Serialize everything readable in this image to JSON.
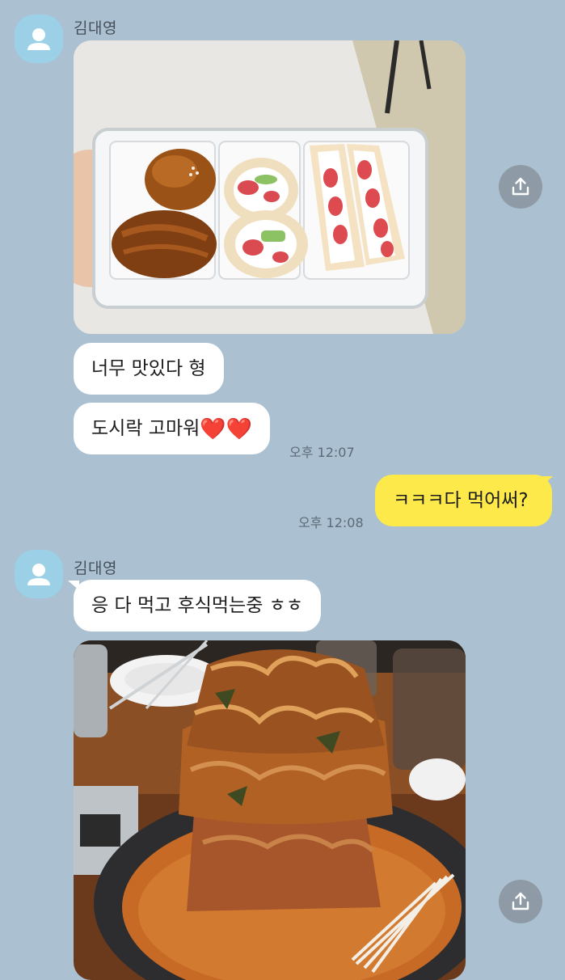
{
  "messages": {
    "first_group": {
      "sender": "김대영",
      "avatar_icon": "person-icon",
      "photo1_icon": "image-lunchbox-photo",
      "bubbles": [
        "너무 맛있다 형",
        "도시락 고마워"
      ],
      "heart_glyphs": "❤️❤️",
      "time": "오후 12:07"
    },
    "mine": {
      "text": "ㅋㅋㅋ다 먹어써?",
      "time": "오후 12:08"
    },
    "second_group": {
      "sender": "김대영",
      "avatar_icon": "person-icon",
      "bubble": "응 다 먹고 후식먹는중 ㅎㅎ",
      "photo2_icon": "image-stew-photo"
    }
  },
  "share_button_icon": "upload-share-icon",
  "colors": {
    "background": "#abc0d1",
    "mine_bubble": "#fee94b",
    "other_bubble": "#ffffff",
    "avatar": "#9bd0e6"
  }
}
